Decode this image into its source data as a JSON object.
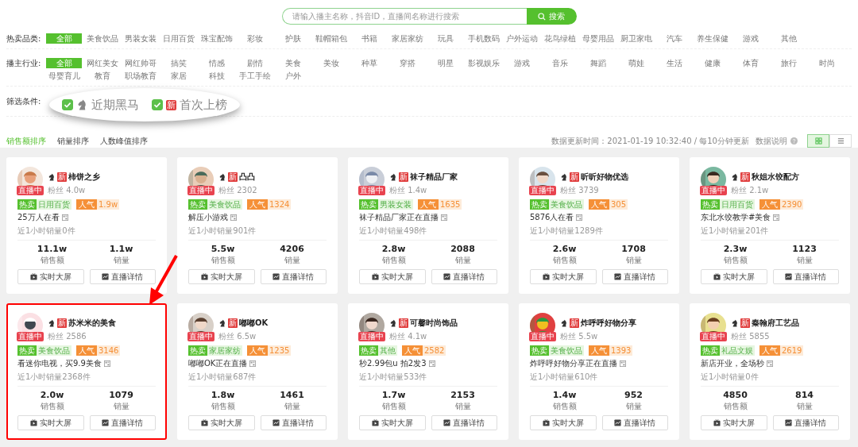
{
  "search": {
    "placeholder": "请输入播主名称，抖音ID，直播间名称进行搜索",
    "button": "搜索"
  },
  "filters": [
    {
      "label": "热卖品类:",
      "options": [
        {
          "label": "全部",
          "selected": true
        },
        {
          "label": "美食饮品",
          "selected": false
        },
        {
          "label": "男装女装",
          "selected": false
        },
        {
          "label": "日用百货",
          "selected": false
        },
        {
          "label": "珠宝配饰",
          "selected": false
        },
        {
          "label": "彩妆",
          "selected": false
        },
        {
          "label": "护肤",
          "selected": false
        },
        {
          "label": "鞋帽箱包",
          "selected": false
        },
        {
          "label": "书籍",
          "selected": false
        },
        {
          "label": "家居家纺",
          "selected": false
        },
        {
          "label": "玩具",
          "selected": false
        },
        {
          "label": "手机数码",
          "selected": false
        },
        {
          "label": "户外运动",
          "selected": false
        },
        {
          "label": "花鸟绿植",
          "selected": false
        },
        {
          "label": "母婴用品",
          "selected": false
        },
        {
          "label": "厨卫家电",
          "selected": false
        },
        {
          "label": "汽车",
          "selected": false
        },
        {
          "label": "养生保健",
          "selected": false
        },
        {
          "label": "游戏",
          "selected": false
        },
        {
          "label": "其他",
          "selected": false
        }
      ]
    },
    {
      "label": "播主行业:",
      "options": [
        {
          "label": "全部",
          "selected": true
        },
        {
          "label": "网红美女",
          "selected": false
        },
        {
          "label": "网红帅哥",
          "selected": false
        },
        {
          "label": "搞笑",
          "selected": false
        },
        {
          "label": "情感",
          "selected": false
        },
        {
          "label": "剧情",
          "selected": false
        },
        {
          "label": "美食",
          "selected": false
        },
        {
          "label": "美妆",
          "selected": false
        },
        {
          "label": "种草",
          "selected": false
        },
        {
          "label": "穿搭",
          "selected": false
        },
        {
          "label": "明星",
          "selected": false
        },
        {
          "label": "影视娱乐",
          "selected": false
        },
        {
          "label": "游戏",
          "selected": false
        },
        {
          "label": "音乐",
          "selected": false
        },
        {
          "label": "舞蹈",
          "selected": false
        },
        {
          "label": "萌娃",
          "selected": false
        },
        {
          "label": "生活",
          "selected": false
        },
        {
          "label": "健康",
          "selected": false
        },
        {
          "label": "体育",
          "selected": false
        },
        {
          "label": "旅行",
          "selected": false
        },
        {
          "label": "时尚",
          "selected": false
        },
        {
          "label": "母婴育儿",
          "selected": false
        },
        {
          "label": "教育",
          "selected": false
        },
        {
          "label": "职场教育",
          "selected": false
        },
        {
          "label": "家居",
          "selected": false
        },
        {
          "label": "科技",
          "selected": false
        },
        {
          "label": "手工手绘",
          "selected": false
        },
        {
          "label": "户外",
          "selected": false
        }
      ]
    }
  ],
  "conditions": {
    "label": "筛选条件:",
    "options": [
      {
        "kind": "horse",
        "label": "近期黑马",
        "checked": true
      },
      {
        "kind": "new",
        "badge": "新",
        "label": "首次上榜",
        "checked": true
      }
    ]
  },
  "sort_tabs": [
    {
      "label": "销售额排序",
      "selected": true
    },
    {
      "label": "销量排序",
      "selected": false
    },
    {
      "label": "人数峰值排序",
      "selected": false
    }
  ],
  "update_info": "数据更新时间：2021-01-19 10:32:40 / 每10分钟更新",
  "data_help": "数据说明",
  "view_modes": [
    {
      "kind": "grid",
      "selected": true
    },
    {
      "kind": "list",
      "selected": false
    }
  ],
  "cards": [
    {
      "name": "柿饼之乡",
      "new_badge": "新",
      "live_badge": "直播中",
      "fans": "粉丝 4.0w",
      "hot_label": "热卖",
      "category": "日用百货",
      "popularity_label": "人气",
      "popularity": "1.9w",
      "title": "25万人在看",
      "hour_sales": "近1小时销量0件",
      "stats": [
        {
          "value": "11.1w",
          "label": "销售额"
        },
        {
          "value": "1.1w",
          "label": "销量"
        }
      ],
      "buttons": [
        "实时大屏",
        "直播详情"
      ],
      "highlighted": false
    },
    {
      "name": "凸凸",
      "new_badge": "新",
      "live_badge": "直播中",
      "fans": "粉丝 2302",
      "hot_label": "热卖",
      "category": "美食饮品",
      "popularity_label": "人气",
      "popularity": "1324",
      "title": "解压小游戏",
      "hour_sales": "近1小时销量901件",
      "stats": [
        {
          "value": "5.5w",
          "label": "销售额"
        },
        {
          "value": "4206",
          "label": "销量"
        }
      ],
      "buttons": [
        "实时大屏",
        "直播详情"
      ],
      "highlighted": false
    },
    {
      "name": "袜子精品厂家",
      "new_badge": "新",
      "live_badge": "直播中",
      "fans": "粉丝 1.4w",
      "hot_label": "热卖",
      "category": "男装女装",
      "popularity_label": "人气",
      "popularity": "1635",
      "title": "袜子精品厂家正在直播",
      "hour_sales": "近1小时销量498件",
      "stats": [
        {
          "value": "2.8w",
          "label": "销售额"
        },
        {
          "value": "2088",
          "label": "销量"
        }
      ],
      "buttons": [
        "实时大屏",
        "直播详情"
      ],
      "highlighted": false
    },
    {
      "name": "昕昕好物优选",
      "new_badge": "新",
      "live_badge": "直播中",
      "fans": "粉丝 3739",
      "hot_label": "热卖",
      "category": "美食饮品",
      "popularity_label": "人气",
      "popularity": "305",
      "title": "5876人在看",
      "hour_sales": "近1小时销量1289件",
      "stats": [
        {
          "value": "2.6w",
          "label": "销售额"
        },
        {
          "value": "1708",
          "label": "销量"
        }
      ],
      "buttons": [
        "实时大屏",
        "直播详情"
      ],
      "highlighted": false
    },
    {
      "name": "秋姐水饺配方",
      "new_badge": "新",
      "live_badge": "直播中",
      "fans": "粉丝 2.1w",
      "hot_label": "热卖",
      "category": "日用百货",
      "popularity_label": "人气",
      "popularity": "2390",
      "title": "东北水饺教学#美食",
      "hour_sales": "近1小时销量201件",
      "stats": [
        {
          "value": "2.3w",
          "label": "销售额"
        },
        {
          "value": "1123",
          "label": "销量"
        }
      ],
      "buttons": [
        "实时大屏",
        "直播详情"
      ],
      "highlighted": false
    },
    {
      "name": "苏米米的美食",
      "new_badge": "新",
      "live_badge": "直播中",
      "fans": "粉丝 2586",
      "hot_label": "热卖",
      "category": "美食饮品",
      "popularity_label": "人气",
      "popularity": "3146",
      "title": "看迷你电视，买9.9美食",
      "hour_sales": "近1小时销量2368件",
      "stats": [
        {
          "value": "2.0w",
          "label": "销售额"
        },
        {
          "value": "1079",
          "label": "销量"
        }
      ],
      "buttons": [
        "实时大屏",
        "直播详情"
      ],
      "highlighted": true
    },
    {
      "name": "嘟嘟OK",
      "new_badge": "新",
      "live_badge": "直播中",
      "fans": "粉丝 6.5w",
      "hot_label": "热卖",
      "category": "家居家纺",
      "popularity_label": "人气",
      "popularity": "1235",
      "title": "嘟嘟OK正在直播",
      "hour_sales": "近1小时销量687件",
      "stats": [
        {
          "value": "1.8w",
          "label": "销售额"
        },
        {
          "value": "1461",
          "label": "销量"
        }
      ],
      "buttons": [
        "实时大屏",
        "直播详情"
      ],
      "highlighted": false
    },
    {
      "name": "可馨时尚饰品",
      "new_badge": "新",
      "live_badge": "直播中",
      "fans": "粉丝 4.1w",
      "hot_label": "热卖",
      "category": "其他",
      "popularity_label": "人气",
      "popularity": "2582",
      "title": "秒2.99包u 拍2发3",
      "hour_sales": "近1小时销量533件",
      "stats": [
        {
          "value": "1.7w",
          "label": "销售额"
        },
        {
          "value": "2153",
          "label": "销量"
        }
      ],
      "buttons": [
        "实时大屏",
        "直播详情"
      ],
      "highlighted": false
    },
    {
      "name": "炸呼呼好物分享",
      "new_badge": "新",
      "live_badge": "直播中",
      "fans": "粉丝 5.5w",
      "hot_label": "热卖",
      "category": "美食饮品",
      "popularity_label": "人气",
      "popularity": "1393",
      "title": "炸呼呼好物分享正在直播",
      "hour_sales": "近1小时销量610件",
      "stats": [
        {
          "value": "1.4w",
          "label": "销售额"
        },
        {
          "value": "952",
          "label": "销量"
        }
      ],
      "buttons": [
        "实时大屏",
        "直播详情"
      ],
      "highlighted": false
    },
    {
      "name": "秦翰府工艺品",
      "new_badge": "新",
      "live_badge": "直播中",
      "fans": "粉丝 5855",
      "hot_label": "热卖",
      "category": "礼品文娱",
      "popularity_label": "人气",
      "popularity": "2619",
      "title": "新店开业，全场秒",
      "hour_sales": "近1小时销量0件",
      "stats": [
        {
          "value": "4850",
          "label": "销售额"
        },
        {
          "value": "814",
          "label": "销量"
        }
      ],
      "buttons": [
        "实时大屏",
        "直播详情"
      ],
      "highlighted": false
    }
  ]
}
